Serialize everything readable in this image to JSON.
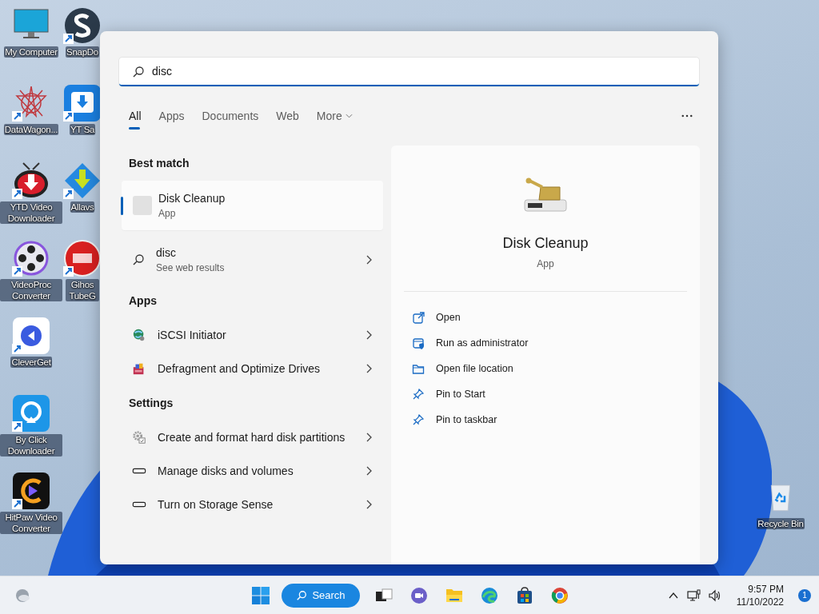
{
  "desktop_icons": [
    {
      "label": "My Computer",
      "kind": "monitor",
      "shortcut": false
    },
    {
      "label": "DataWagon...",
      "kind": "star",
      "shortcut": true
    },
    {
      "label": "YTD Video Downloader",
      "kind": "tv",
      "shortcut": true
    },
    {
      "label": "VideoProc Converter",
      "kind": "reel",
      "shortcut": true
    },
    {
      "label": "CleverGet",
      "kind": "clever",
      "shortcut": true
    },
    {
      "label": "By Click Downloader",
      "kind": "byclick",
      "shortcut": true
    },
    {
      "label": "HitPaw Video Converter",
      "kind": "hitpaw",
      "shortcut": true
    }
  ],
  "desktop_icons_column_2": [
    {
      "label": "SnapDo",
      "kind": "snap",
      "shortcut": true
    },
    {
      "label": "YT Sa",
      "kind": "download",
      "shortcut": true
    },
    {
      "label": "Allavs",
      "kind": "allavs",
      "shortcut": true
    },
    {
      "label": "Gihos TubeG",
      "kind": "tube",
      "shortcut": true
    }
  ],
  "recycle_bin": {
    "label": "Recycle Bin"
  },
  "search": {
    "value": "disc"
  },
  "tabs": [
    {
      "label": "All",
      "selected": true,
      "kind": "tab"
    },
    {
      "label": "Apps",
      "selected": false,
      "kind": "tab"
    },
    {
      "label": "Documents",
      "selected": false,
      "kind": "tab"
    },
    {
      "label": "Web",
      "selected": false,
      "kind": "tab"
    },
    {
      "label": "More",
      "selected": false,
      "kind": "dropdown"
    }
  ],
  "best_match": {
    "heading": "Best match",
    "item": {
      "title": "Disk Cleanup",
      "subtitle": "App",
      "selected": true
    }
  },
  "web_result": {
    "title": "disc",
    "subtitle": "See web results"
  },
  "apps": {
    "heading": "Apps",
    "items": [
      {
        "title": "iSCSI Initiator",
        "kind": "globe"
      },
      {
        "title": "Defragment and Optimize Drives",
        "kind": "defrag"
      }
    ]
  },
  "settings": {
    "heading": "Settings",
    "items": [
      {
        "title": "Create and format hard disk partitions",
        "kind": "gear"
      },
      {
        "title": "Manage disks and volumes",
        "kind": "drive"
      },
      {
        "title": "Turn on Storage Sense",
        "kind": "drive"
      }
    ]
  },
  "detail": {
    "title": "Disk Cleanup",
    "subtitle": "App",
    "actions": [
      {
        "label": "Open",
        "kind": "open"
      },
      {
        "label": "Run as administrator",
        "kind": "admin"
      },
      {
        "label": "Open file location",
        "kind": "folder"
      },
      {
        "label": "Pin to Start",
        "kind": "pin"
      },
      {
        "label": "Pin to taskbar",
        "kind": "pin"
      }
    ]
  },
  "taskbar": {
    "search_label": "Search",
    "apps": [
      {
        "kind": "taskview"
      },
      {
        "kind": "chat"
      },
      {
        "kind": "explorer"
      },
      {
        "kind": "edge"
      },
      {
        "kind": "store"
      },
      {
        "kind": "chrome"
      }
    ],
    "time": "9:57 PM",
    "date": "11/10/2022",
    "notifications": "1"
  }
}
